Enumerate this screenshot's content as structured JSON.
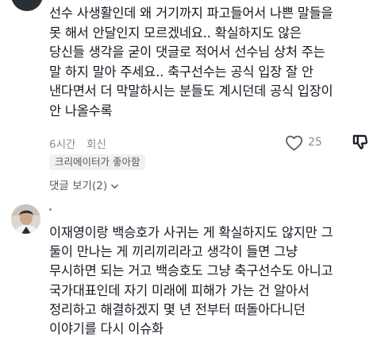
{
  "comments": [
    {
      "text": "선수 사생활인데 왜 거기까지 파고들어서 나쁜 말들을\n못 해서 안달인지 모르겠네요.. 확실하지도 않은\n당신들 생각을 굳이 댓글로 적어서 선수님 상처 주는\n말 하지 말아 주세요.. 축구선수는 공식 입장 잘 안\n낸다면서 더 막말하시는 분들도 계시던데 공식 입장이\n안 나올수록",
      "time": "6시간",
      "reply_label": "회신",
      "like_count": "25",
      "creator_badge": "크리에이터가 좋아함",
      "view_replies": "댓글 보기(2)",
      "icons": {
        "like": "heart-outline-icon",
        "dislike": "thumbs-down-icon",
        "expand": "chevron-down-icon"
      }
    },
    {
      "text": "이재영이랑 백승호가 사귀는 게 확실하지도 않지만 그\n둘이 만나는 게 끼리끼리라고 생각이 들면 그냥\n무시하면 되는 거고 백승호도 그냥 축구선수도 아니고\n국가대표인데 자기 미래에 피해가 가는 건 알아서\n정리하고 해결하겠지 몇 년 전부터 떠돌아다니던\n이야기를 다시 이슈화"
    }
  ],
  "colors": {
    "text": "#161823",
    "muted": "#8a8b91",
    "badge_bg": "#f1f1f2"
  }
}
